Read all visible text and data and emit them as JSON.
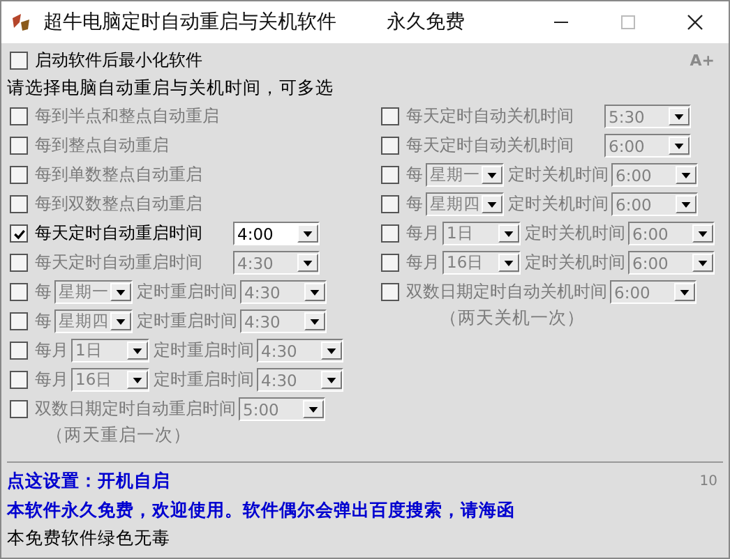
{
  "window": {
    "title": "超牛电脑定时自动重启与关机软件",
    "subtitle": "永久免费"
  },
  "minimize_option": {
    "label": "启动软件后最小化软件",
    "checked": false
  },
  "font_button": "A+",
  "instruction": "请选择电脑自动重启与关机时间，可多选",
  "restart_options": [
    {
      "checked": false,
      "parts": [
        {
          "kind": "text",
          "text": "每到半点和整点自动重启"
        }
      ]
    },
    {
      "checked": false,
      "parts": [
        {
          "kind": "text",
          "text": "每到整点自动重启"
        }
      ]
    },
    {
      "checked": false,
      "parts": [
        {
          "kind": "text",
          "text": "每到单数整点自动重启"
        }
      ]
    },
    {
      "checked": false,
      "parts": [
        {
          "kind": "text",
          "text": "每到双数整点自动重启"
        }
      ]
    },
    {
      "checked": true,
      "parts": [
        {
          "kind": "text",
          "text": "每天定时自动重启时间"
        },
        {
          "kind": "time",
          "value": "4:00"
        }
      ]
    },
    {
      "checked": false,
      "parts": [
        {
          "kind": "text",
          "text": "每天定时自动重启时间"
        },
        {
          "kind": "time",
          "value": "4:30"
        }
      ]
    },
    {
      "checked": false,
      "parts": [
        {
          "kind": "text",
          "text": "每"
        },
        {
          "kind": "day",
          "value": "星期一"
        },
        {
          "kind": "text",
          "text": "定时重启时间"
        },
        {
          "kind": "time",
          "value": "4:30"
        }
      ]
    },
    {
      "checked": false,
      "parts": [
        {
          "kind": "text",
          "text": "每"
        },
        {
          "kind": "day",
          "value": "星期四"
        },
        {
          "kind": "text",
          "text": "定时重启时间"
        },
        {
          "kind": "time",
          "value": "4:30"
        }
      ]
    },
    {
      "checked": false,
      "parts": [
        {
          "kind": "text",
          "text": "每月"
        },
        {
          "kind": "day",
          "value": "1日"
        },
        {
          "kind": "text",
          "text": "定时重启时间"
        },
        {
          "kind": "time",
          "value": "4:30"
        }
      ]
    },
    {
      "checked": false,
      "parts": [
        {
          "kind": "text",
          "text": "每月"
        },
        {
          "kind": "day",
          "value": "16日"
        },
        {
          "kind": "text",
          "text": "定时重启时间"
        },
        {
          "kind": "time",
          "value": "4:30"
        }
      ]
    },
    {
      "checked": false,
      "parts": [
        {
          "kind": "text",
          "text": "双数日期定时自动重启时间"
        },
        {
          "kind": "time",
          "value": "5:00"
        }
      ],
      "note": "（两天重启一次）"
    }
  ],
  "shutdown_options": [
    {
      "checked": false,
      "parts": [
        {
          "kind": "text",
          "text": "每天定时自动关机时间"
        },
        {
          "kind": "time",
          "value": "5:30"
        }
      ]
    },
    {
      "checked": false,
      "parts": [
        {
          "kind": "text",
          "text": "每天定时自动关机时间"
        },
        {
          "kind": "time",
          "value": "6:00"
        }
      ]
    },
    {
      "checked": false,
      "parts": [
        {
          "kind": "text",
          "text": "每"
        },
        {
          "kind": "day",
          "value": "星期一"
        },
        {
          "kind": "text",
          "text": "定时关机时间"
        },
        {
          "kind": "time",
          "value": "6:00"
        }
      ]
    },
    {
      "checked": false,
      "parts": [
        {
          "kind": "text",
          "text": "每"
        },
        {
          "kind": "day",
          "value": "星期四"
        },
        {
          "kind": "text",
          "text": "定时关机时间"
        },
        {
          "kind": "time",
          "value": "6:00"
        }
      ]
    },
    {
      "checked": false,
      "parts": [
        {
          "kind": "text",
          "text": "每月"
        },
        {
          "kind": "day",
          "value": "1日"
        },
        {
          "kind": "text",
          "text": "定时关机时间"
        },
        {
          "kind": "time",
          "value": "6:00"
        }
      ]
    },
    {
      "checked": false,
      "parts": [
        {
          "kind": "text",
          "text": "每月"
        },
        {
          "kind": "day",
          "value": "16日"
        },
        {
          "kind": "text",
          "text": "定时关机时间"
        },
        {
          "kind": "time",
          "value": "6:00"
        }
      ]
    },
    {
      "checked": false,
      "parts": [
        {
          "kind": "text",
          "text": "双数日期定时自动关机时间"
        },
        {
          "kind": "time",
          "value": "6:00"
        }
      ],
      "note": "（两天关机一次）"
    }
  ],
  "footer": {
    "setting_link": "点这设置：开机自启",
    "version": "10",
    "notice": "本软件永久免费，欢迎使用。软件偶尔会弹出百度搜索，请海函",
    "status": "本免费软件绿色无毒"
  }
}
